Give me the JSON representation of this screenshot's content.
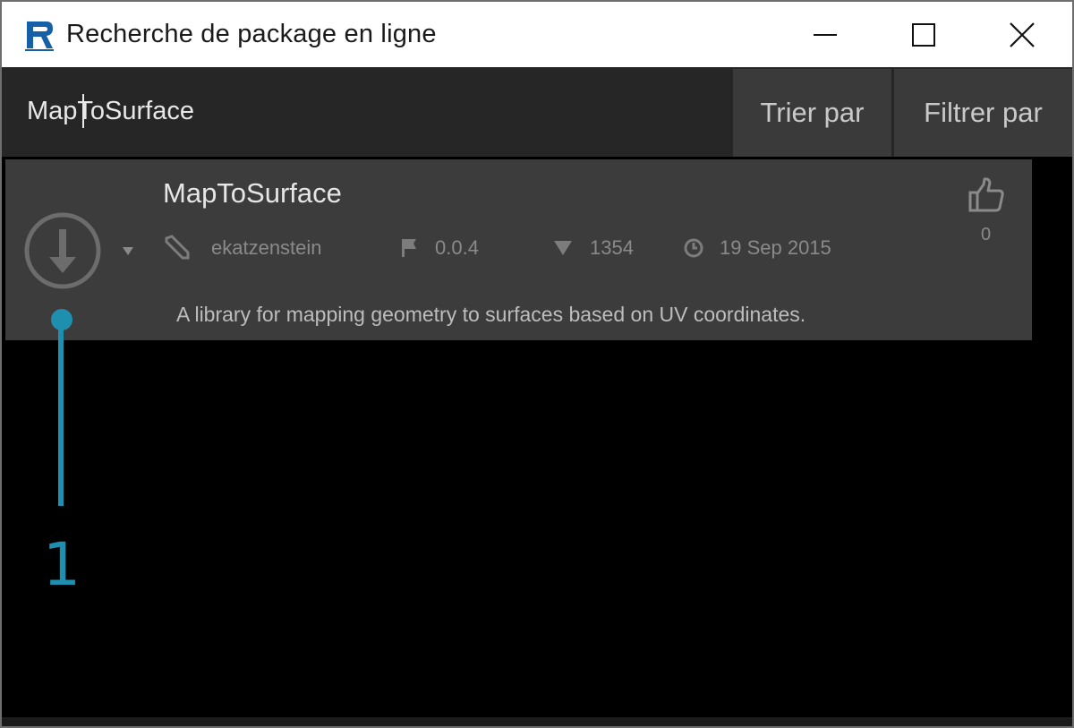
{
  "window": {
    "title": "Recherche de package en ligne",
    "icons": {
      "app": "revit-logo-icon",
      "minimize": "minimize-icon",
      "maximize": "maximize-icon",
      "close": "close-icon"
    }
  },
  "search": {
    "value": "MapToSurface",
    "sort_label": "Trier par",
    "filter_label": "Filtrer par"
  },
  "package": {
    "name": "MapToSurface",
    "author": "ekatzenstein",
    "version": "0.0.4",
    "downloads": "1354",
    "date": "19 Sep 2015",
    "description": "A library for mapping geometry to surfaces based on UV coordinates.",
    "votes": "0",
    "icons": {
      "install": "download-arrow-icon",
      "menu": "dropdown-caret-icon",
      "author": "pencil-icon",
      "version": "flag-icon",
      "downloads": "downloads-triangle-icon",
      "date": "clock-icon",
      "vote": "thumbs-up-icon"
    }
  },
  "callout": {
    "number": "1",
    "color": "#1f8fb0"
  },
  "colors": {
    "accent": "#1f8fb0",
    "card": "#3c3c3c",
    "searchbar": "#262626",
    "background": "#000000"
  }
}
